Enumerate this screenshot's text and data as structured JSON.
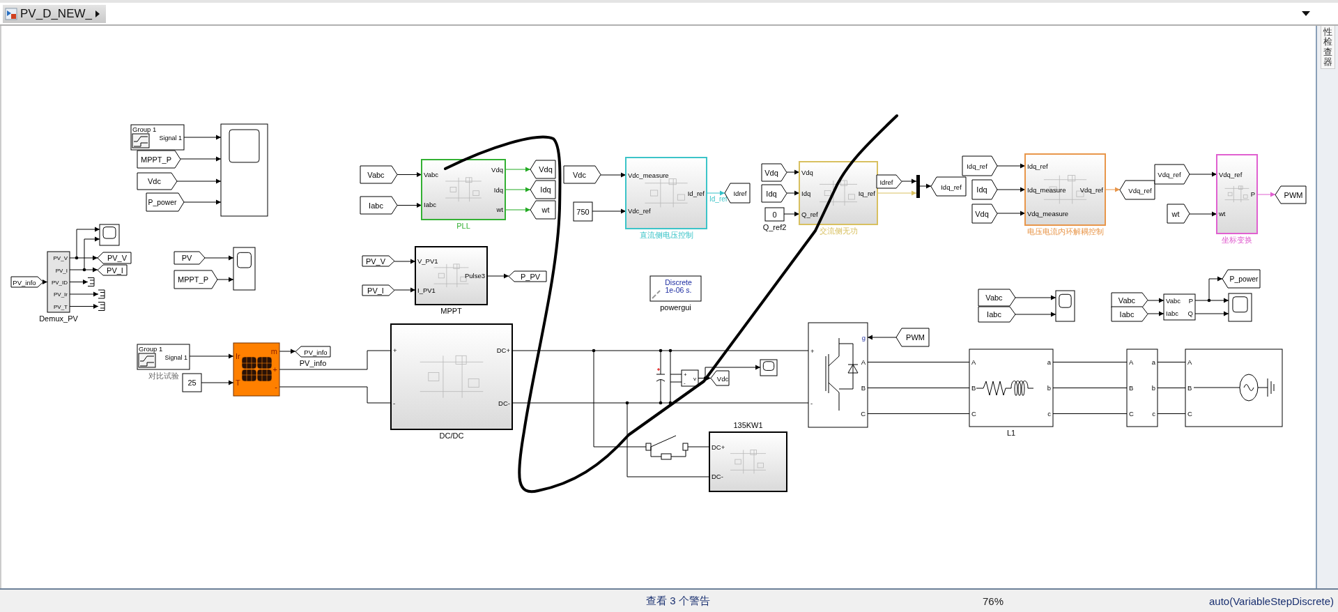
{
  "tab": {
    "title": "PV_D_NEW_"
  },
  "side_panel": {
    "title": "性检查器"
  },
  "blocks": [
    {
      "kind": "signal_builder",
      "group": "Group 1",
      "signal": "Signal 1"
    },
    {
      "kind": "tag_right",
      "text": "MPPT_P"
    },
    {
      "kind": "tag_right",
      "text": "Vdc"
    },
    {
      "kind": "tag_right",
      "text": "P_power"
    },
    {
      "kind": "scope"
    },
    {
      "kind": "scope"
    },
    {
      "kind": "tag_right",
      "text": "PV_info"
    },
    {
      "kind": "demux",
      "ports_out": [
        "PV_V",
        "PV_I",
        "PV_ID",
        "PV_Ir",
        "PV_T"
      ],
      "caption": "Demux_PV"
    },
    {
      "kind": "tag_left",
      "text": "PV_V"
    },
    {
      "kind": "tag_left",
      "text": "PV_I"
    },
    {
      "kind": "tag_right",
      "text": "PV"
    },
    {
      "kind": "tag_right",
      "text": "MPPT_P"
    },
    {
      "kind": "scope"
    },
    {
      "kind": "tag_right",
      "text": "Vabc"
    },
    {
      "kind": "tag_right",
      "text": "Iabc"
    },
    {
      "kind": "subsystem",
      "ports_in": [
        "Vabc",
        "Iabc"
      ],
      "ports_out": [
        "Vdq",
        "Idq",
        "wt"
      ],
      "caption": "PLL",
      "color": "#33b033"
    },
    {
      "kind": "tag_left",
      "text": "Vdq"
    },
    {
      "kind": "tag_left",
      "text": "Idq"
    },
    {
      "kind": "tag_left",
      "text": "wt"
    },
    {
      "kind": "tag_right",
      "text": "Vdc"
    },
    {
      "kind": "constant",
      "text": "750"
    },
    {
      "kind": "subsystem",
      "ports_in": [
        "Vdc_measure",
        "Vdc_ref"
      ],
      "ports_out": [
        "Id_ref"
      ],
      "caption": "直流侧电压控制",
      "color": "#3cc4c8",
      "signal_label": "Id_ref"
    },
    {
      "kind": "tag_left",
      "text": "Idref"
    },
    {
      "kind": "tag_right",
      "text": "PV_V"
    },
    {
      "kind": "tag_right",
      "text": "PV_I"
    },
    {
      "kind": "subsystem",
      "ports_in": [
        "V_PV1",
        "I_PV1"
      ],
      "ports_out": [
        "Pulse3"
      ],
      "caption": "MPPT",
      "color": "#000000"
    },
    {
      "kind": "tag_left",
      "text": "P_PV"
    },
    {
      "kind": "powergui",
      "lines": [
        "Discrete",
        "1e-06 s."
      ],
      "caption": "powergui"
    },
    {
      "kind": "tag_right",
      "text": "Vdq"
    },
    {
      "kind": "tag_right",
      "text": "Idq"
    },
    {
      "kind": "constant",
      "text": "0",
      "caption": "Q_ref2"
    },
    {
      "kind": "subsystem",
      "ports_in": [
        "Vdq",
        "Idq",
        "Q_ref"
      ],
      "ports_out": [
        "Iq_ref"
      ],
      "caption": "交流侧无功",
      "color": "#d8c060"
    },
    {
      "kind": "tag_right",
      "text": "Idref"
    },
    {
      "kind": "tag_left",
      "text": "Idq_ref"
    },
    {
      "kind": "tag_right",
      "text": "Idq_ref"
    },
    {
      "kind": "tag_right",
      "text": "Idq"
    },
    {
      "kind": "tag_right",
      "text": "Vdq"
    },
    {
      "kind": "subsystem",
      "ports_in": [
        "Idq_ref",
        "Idq_measure",
        "Vdq_measure"
      ],
      "ports_out": [
        "Vdq_ref"
      ],
      "caption": "电压电流内环解耦控制",
      "color": "#e8964a"
    },
    {
      "kind": "tag_left",
      "text": "Vdq_ref"
    },
    {
      "kind": "tag_right",
      "text": "Vdq_ref"
    },
    {
      "kind": "tag_right",
      "text": "wt"
    },
    {
      "kind": "subsystem",
      "ports_in": [
        "Vdq_ref",
        "wt"
      ],
      "ports_out": [
        "P"
      ],
      "caption": "坐标变换",
      "color": "#e060d0"
    },
    {
      "kind": "tag_left",
      "text": "PWM"
    },
    {
      "kind": "tag_right",
      "text": "Vabc"
    },
    {
      "kind": "tag_right",
      "text": "Iabc"
    },
    {
      "kind": "scope"
    },
    {
      "kind": "tag_left",
      "text": "P_power"
    },
    {
      "kind": "tag_right",
      "text": "Vabc"
    },
    {
      "kind": "tag_right",
      "text": "Iabc"
    },
    {
      "kind": "power_meas",
      "ports_in": [
        "Vabc",
        "Iabc"
      ],
      "ports_out": [
        "P",
        "Q"
      ]
    },
    {
      "kind": "scope"
    },
    {
      "kind": "signal_builder",
      "group": "Group 1",
      "signal": "Signal 1",
      "caption": "对比试验"
    },
    {
      "kind": "constant",
      "text": "25"
    },
    {
      "kind": "pv_array",
      "ports_in": [
        "Ir",
        "T"
      ],
      "ports_out": [
        "m",
        "+",
        "-"
      ]
    },
    {
      "kind": "tag_left",
      "text": "PV_info",
      "caption": "PV_info"
    },
    {
      "kind": "subsystem",
      "ports_in": [
        "+",
        "-"
      ],
      "ports_out": [
        "DC+",
        "DC-"
      ],
      "caption": "DC/DC",
      "color": "#000000"
    },
    {
      "kind": "voltmeter",
      "ports_in": [
        "+",
        "-"
      ],
      "ports_out": [
        "v"
      ]
    },
    {
      "kind": "tag_left",
      "text": "Vdc"
    },
    {
      "kind": "scope"
    },
    {
      "kind": "subsystem",
      "ports_in": [
        "DC+",
        "DC-"
      ],
      "caption": "135KW1",
      "color": "#000000"
    },
    {
      "kind": "inverter",
      "ports_in": [
        "+",
        "-"
      ],
      "ports_out": [
        "g",
        "A",
        "B",
        "C"
      ]
    },
    {
      "kind": "tag_left",
      "text": "PWM"
    },
    {
      "kind": "rl_branch",
      "ports_in": [
        "A",
        "B",
        "C"
      ],
      "ports_out": [
        "a",
        "b",
        "c"
      ],
      "caption": "L1"
    },
    {
      "kind": "measurement",
      "ports_in": [
        "A",
        "B",
        "C"
      ],
      "ports_out": [
        "a",
        "b",
        "c"
      ]
    },
    {
      "kind": "source",
      "ports_in": [
        "A",
        "B",
        "C"
      ]
    }
  ],
  "status_bar": {
    "warnings": "查看 3 个警告",
    "zoom": "76%",
    "solver": "auto(VariableStepDiscrete)"
  }
}
